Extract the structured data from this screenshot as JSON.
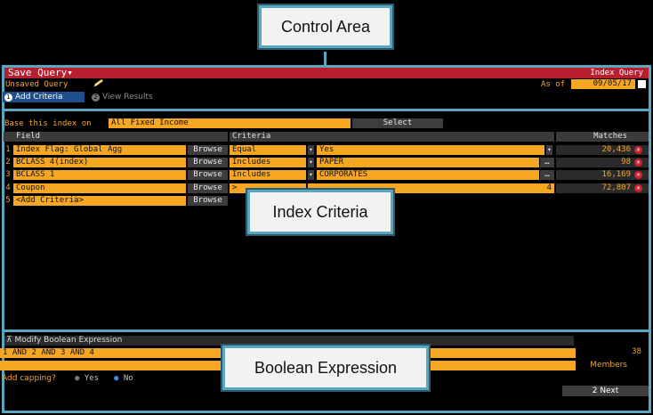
{
  "callouts": {
    "control_area": "Control Area",
    "index_criteria": "Index Criteria",
    "boolean_expression": "Boolean Expression"
  },
  "header": {
    "title": "Save Query",
    "title_suffix": "▾",
    "right_label": "Index Query",
    "status": "Unsaved Query",
    "as_of_label": "As of",
    "as_of_date": "09/05/17"
  },
  "steps": [
    {
      "num": "1",
      "label": "Add Criteria"
    },
    {
      "num": "2",
      "label": "View Results"
    }
  ],
  "base": {
    "label": "Base this index on",
    "value": "All Fixed Income",
    "select_label": "Select"
  },
  "table": {
    "headers": {
      "field": "Field",
      "criteria": "Criteria",
      "matches": "Matches"
    },
    "browse_label": "Browse",
    "rows": [
      {
        "num": "1",
        "field": "Index Flag: Global Agg",
        "operator": "Equal",
        "value": "Yes",
        "matches": "20,436"
      },
      {
        "num": "2",
        "field": "BCLASS 4(index)",
        "operator": "Includes",
        "value": "PAPER",
        "matches": "98"
      },
      {
        "num": "3",
        "field": "BCLASS 1",
        "operator": "Includes",
        "value": "CORPORATES",
        "matches": "16,169"
      },
      {
        "num": "4",
        "field": "Coupon",
        "operator": ">",
        "value": "4",
        "matches": "72,807"
      },
      {
        "num": "5",
        "field": "<Add Criteria>"
      }
    ]
  },
  "boolean": {
    "section_label": "Modify Boolean Expression",
    "expression": "1 AND 2 AND 3 AND 4",
    "members_count": "38",
    "members_label": "Members",
    "capping_label": "Add capping?",
    "capping_yes": "Yes",
    "capping_no": "No",
    "next_num": "2",
    "next_label": "Next"
  },
  "colors": {
    "accent_orange": "#f5a623",
    "title_red": "#b81f2e",
    "callout_border": "#5aa6c0"
  }
}
